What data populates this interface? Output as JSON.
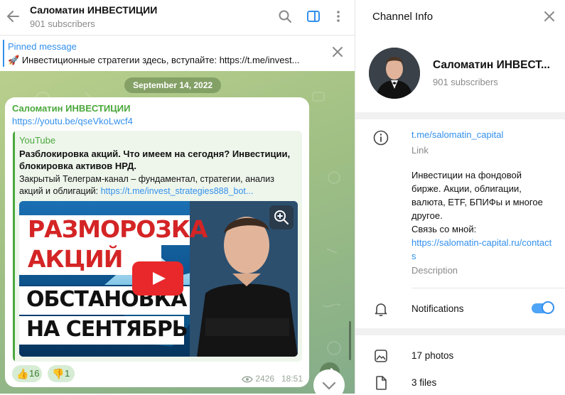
{
  "header": {
    "title": "Саломатин ИНВЕСТИЦИИ",
    "subscribers": "901 subscribers",
    "icons": [
      "back-arrow-icon",
      "search-icon",
      "sidebar-toggle-icon",
      "more-vertical-icon"
    ]
  },
  "pinned": {
    "title": "Pinned message",
    "emoji": "🚀",
    "text": "Инвестиционные стратегии здесь, вступайте: https://t.me/invest..."
  },
  "chat": {
    "date": "September 14, 2022",
    "message": {
      "sender": "Саломатин ИНВЕСТИЦИИ",
      "link": "https://youtu.be/qseVkoLwcf4",
      "preview": {
        "site": "YouTube",
        "title": "Разблокировка акций. Что имеем на сегодня? Инвестиции, блокировка активов НРД.",
        "desc": "Закрытый Телеграм-канал – фундаментал, стратегии, анализ акций и облигаций: ",
        "desc_link": "https://t.me/invest_strategies888_bot...",
        "thumb_text": [
          "РАЗМОРОЗКА",
          "АКЦИЙ",
          "ОБСТАНОВКА",
          "НА СЕНТЯБРЬ"
        ]
      },
      "reactions": [
        {
          "emoji": "👍",
          "count": "16"
        },
        {
          "emoji": "👎",
          "count": "1"
        }
      ],
      "views": "2426",
      "time": "18:51"
    },
    "colors": {
      "accent": "#3390ec",
      "sender": "#4aa83b",
      "play": "#e8282a"
    }
  },
  "panel": {
    "title": "Channel Info",
    "channel_name": "Саломатин ИНВЕСТ...",
    "subscribers": "901 subscribers",
    "link": "t.me/salomatin_capital",
    "link_label": "Link",
    "description": "Инвестиции на фондовой бирже. Акции, облигации, валюта, ETF, БПИФы и многое другое.",
    "contact_prefix": "Связь со мной:",
    "contact_link": "https://salomatin-capital.ru/contacts",
    "description_label": "Description",
    "notifications": "Notifications",
    "notifications_on": true,
    "photos": "17 photos",
    "files": "3 files"
  }
}
